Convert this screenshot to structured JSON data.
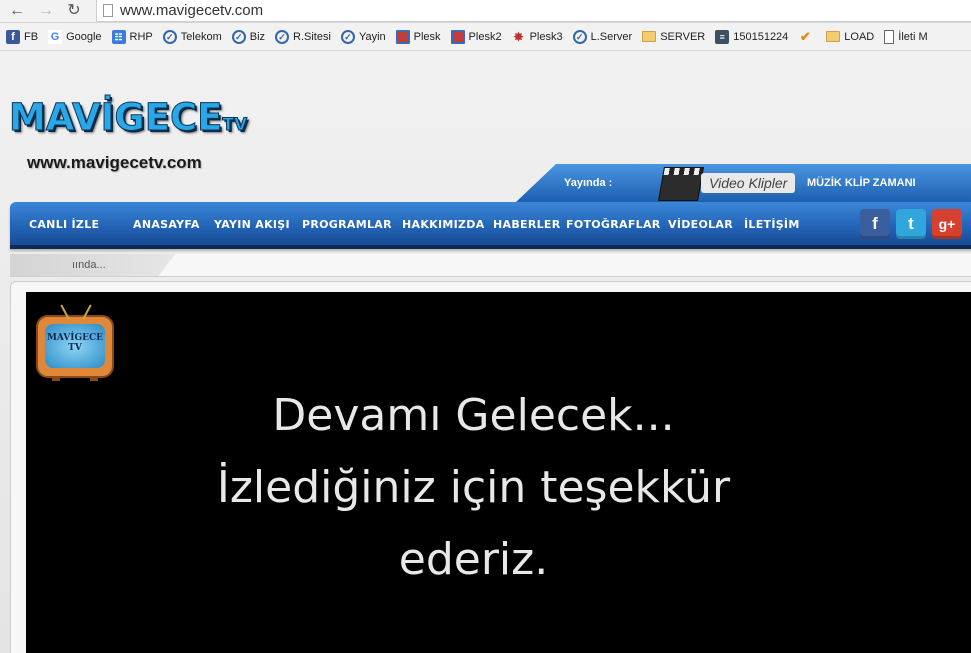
{
  "browser": {
    "url": "www.mavigecetv.com",
    "bookmarks": [
      {
        "label": "FB",
        "icon": "facebook-icon"
      },
      {
        "label": "Google",
        "icon": "google-icon"
      },
      {
        "label": "RHP",
        "icon": "rhp-icon"
      },
      {
        "label": "Telekom",
        "icon": "check-circle-icon"
      },
      {
        "label": "Biz",
        "icon": "check-circle-icon"
      },
      {
        "label": "R.Sitesi",
        "icon": "check-circle-icon"
      },
      {
        "label": "Yayin",
        "icon": "check-circle-icon"
      },
      {
        "label": "Plesk",
        "icon": "plesk-icon"
      },
      {
        "label": "Plesk2",
        "icon": "plesk-icon"
      },
      {
        "label": "Plesk3",
        "icon": "plesk3-icon"
      },
      {
        "label": "L.Server",
        "icon": "check-circle-icon"
      },
      {
        "label": "SERVER",
        "icon": "folder-icon"
      },
      {
        "label": "150151224",
        "icon": "server-icon"
      },
      {
        "label": "",
        "icon": "tick-icon"
      },
      {
        "label": "LOAD",
        "icon": "folder-icon"
      },
      {
        "label": "İleti M",
        "icon": "document-icon"
      }
    ]
  },
  "site": {
    "logo_text": "MAVİGECE",
    "logo_suffix": "TV",
    "url_caption": "www.mavigecetv.com"
  },
  "onair": {
    "label": "Yayında :",
    "badge": "Video Klipler",
    "program": "MÜZİK KLİP ZAMANI"
  },
  "nav": {
    "items": [
      "CANLI İZLE",
      "ANASAYFA",
      "YAYIN AKIŞI",
      "PROGRAMLAR",
      "HAKKIMIZDA",
      "HABERLER",
      "FOTOĞRAFLAR",
      "VİDEOLAR",
      "İLETİŞİM"
    ],
    "social": {
      "facebook": "f",
      "twitter": "t",
      "googleplus": "g+"
    }
  },
  "ticker": {
    "text": "ıında..."
  },
  "video": {
    "logo_text": "MAVİGECE",
    "logo_sub": "TV",
    "caption_lines": [
      "Devamı Gelecek...",
      "İzlediğiniz için teşekkür",
      "ederiz."
    ]
  },
  "colors": {
    "nav_blue": "#2262b4",
    "onair_blue": "#3a86d6",
    "logo_cyan": "#29a7e6"
  }
}
